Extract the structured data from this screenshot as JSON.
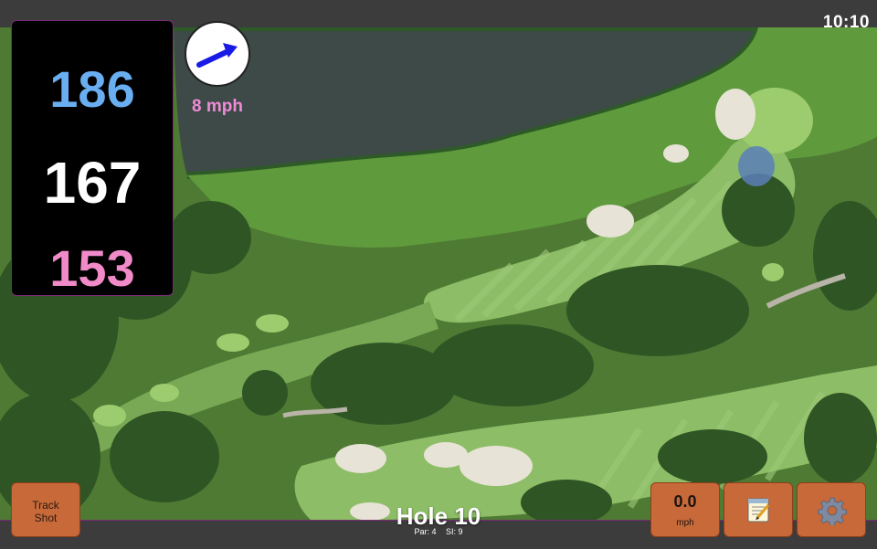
{
  "status_bar": {
    "time": "10:10"
  },
  "distances": {
    "back": "186",
    "middle": "167",
    "front": "153"
  },
  "wind": {
    "speed": "8 mph",
    "direction_icon": "wind-arrow-icon"
  },
  "buttons": {
    "track_shot_line1": "Track",
    "track_shot_line2": "Shot",
    "speed_value": "0.0",
    "speed_unit": "mph",
    "notes_icon": "notepad-icon",
    "settings_icon": "gear-icon"
  },
  "hole": {
    "title": "Hole 10",
    "par": "Par: 4",
    "si": "SI: 9"
  },
  "colors": {
    "back_distance": "#6aaef2",
    "middle_distance": "#ffffff",
    "front_distance": "#f08ac8",
    "wind_text": "#ef8bd6",
    "button": "#c8693a",
    "accent_border": "#7a2a78"
  }
}
